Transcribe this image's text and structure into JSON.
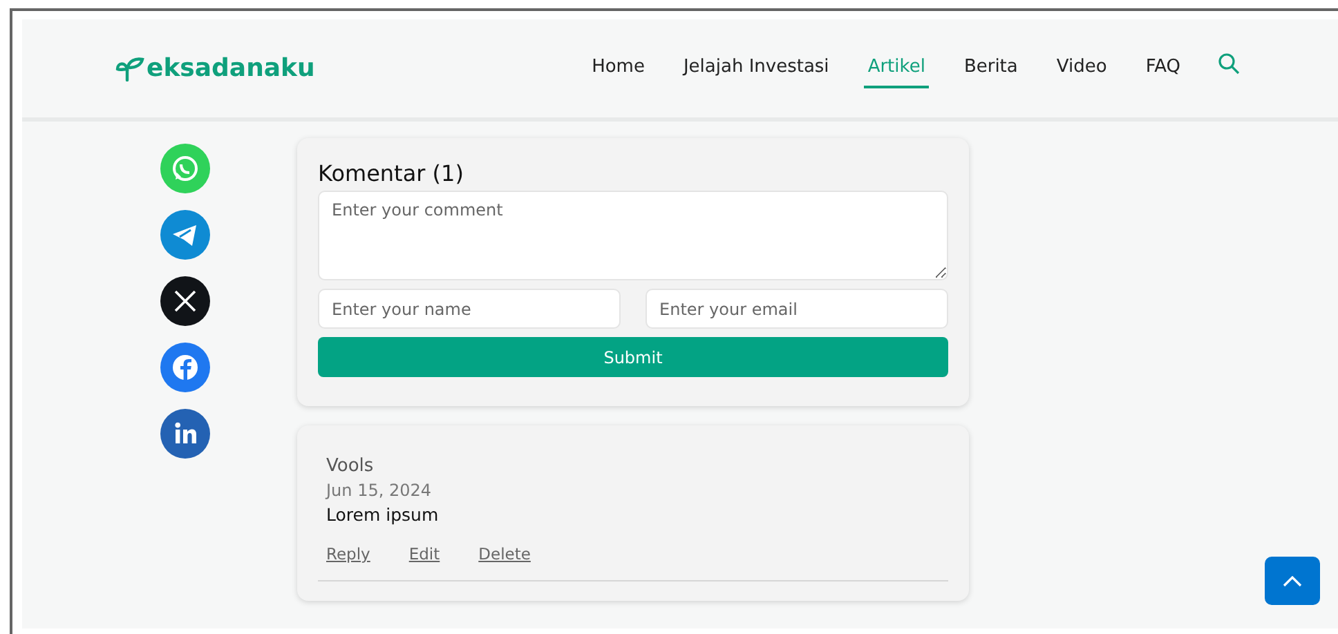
{
  "header": {
    "logo_text": "eksadanaku",
    "nav": [
      {
        "label": "Home",
        "selected": false
      },
      {
        "label": "Jelajah Investasi",
        "selected": false
      },
      {
        "label": "Artikel",
        "selected": true
      },
      {
        "label": "Berita",
        "selected": false
      },
      {
        "label": "Video",
        "selected": false
      },
      {
        "label": "FAQ",
        "selected": false
      }
    ]
  },
  "share": [
    {
      "kind": "whatsapp"
    },
    {
      "kind": "telegram"
    },
    {
      "kind": "x"
    },
    {
      "kind": "facebook"
    },
    {
      "kind": "linkedin"
    }
  ],
  "comment_form": {
    "title": "Komentar (1)",
    "comment": {
      "placeholder": "Enter your comment"
    },
    "name": {
      "placeholder": "Enter your name"
    },
    "email": {
      "placeholder": "Enter your email"
    },
    "submit": "Submit"
  },
  "comments": [
    {
      "author": "Vools",
      "date": "Jun 15, 2024",
      "text": "Lorem ipsum",
      "actions": [
        "Reply",
        "Edit",
        "Delete"
      ]
    }
  ]
}
